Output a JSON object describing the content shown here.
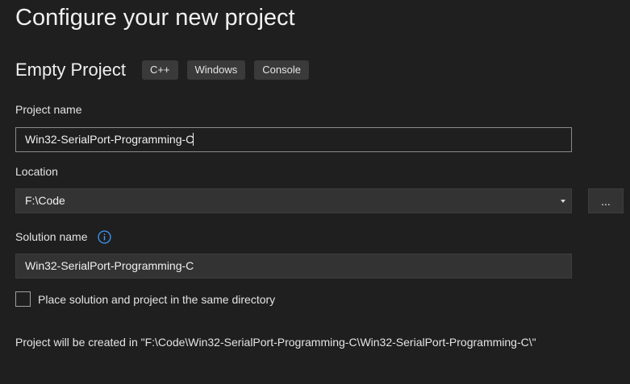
{
  "header": {
    "title": "Configure your new project"
  },
  "template": {
    "name": "Empty Project",
    "tags": [
      "C++",
      "Windows",
      "Console"
    ]
  },
  "project_name": {
    "label": "Project name",
    "value": "Win32-SerialPort-Programming-C"
  },
  "location": {
    "label": "Location",
    "value": "F:\\Code",
    "browse_label": "..."
  },
  "solution_name": {
    "label": "Solution name",
    "value": "Win32-SerialPort-Programming-C",
    "info_icon": "info-circle-icon"
  },
  "same_directory": {
    "label": "Place solution and project in the same directory",
    "checked": false
  },
  "path_info": "Project will be created in \"F:\\Code\\Win32-SerialPort-Programming-C\\Win32-SerialPort-Programming-C\\\"",
  "colors": {
    "background": "#1f1f1f",
    "field_background": "#333333",
    "tag_background": "#3a3a3a",
    "info_accent": "#3d9bff"
  }
}
